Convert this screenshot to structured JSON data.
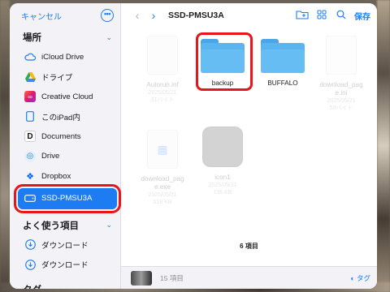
{
  "sidebar": {
    "cancel_label": "キャンセル",
    "more_glyph": "•••",
    "locations_title": "場所",
    "locations": [
      {
        "label": "iCloud Drive",
        "icon": "cloud-icon"
      },
      {
        "label": "ドライブ",
        "icon": "google-drive-icon"
      },
      {
        "label": "Creative Cloud",
        "icon": "creative-cloud-icon"
      },
      {
        "label": "このiPad内",
        "icon": "ipad-icon"
      },
      {
        "label": "Documents",
        "icon": "documents-icon"
      },
      {
        "label": "Drive",
        "icon": "drive-icon"
      },
      {
        "label": "Dropbox",
        "icon": "dropbox-icon"
      },
      {
        "label": "SSD-PMSU3A",
        "icon": "external-drive-icon",
        "selected": true
      }
    ],
    "favorites_title": "よく使う項目",
    "favorites": [
      {
        "label": "ダウンロード",
        "icon": "download-icon"
      },
      {
        "label": "ダウンロード",
        "icon": "download-icon"
      }
    ],
    "tags_title": "タグ"
  },
  "toolbar": {
    "title": "SSD-PMSU3A",
    "back_glyph": "‹",
    "forward_glyph": "›",
    "save_label": "保存"
  },
  "files": [
    {
      "name": "Autorun.inf",
      "meta": "2025/05/21\n31バイト",
      "kind": "doc",
      "dim": true
    },
    {
      "name": "backup",
      "meta": "",
      "kind": "folder",
      "highlighted": true
    },
    {
      "name": "BUFFALO",
      "meta": "",
      "kind": "folder"
    },
    {
      "name": "download_pag\ne.ini",
      "meta": "2025/05/21\n58バイト",
      "kind": "doc",
      "dim": true
    },
    {
      "name": "download_pag\ne.exe",
      "meta": "2025/05/21\n518 KB",
      "kind": "exe",
      "dim": true
    },
    {
      "name": "icon1",
      "meta": "2025/05/21\n136 KB",
      "kind": "drive-image",
      "dim": true
    }
  ],
  "footer": {
    "count": "6 項目",
    "items_text": "15 項目",
    "tag_label": "タグ"
  },
  "colors": {
    "accent": "#1e7cf2",
    "highlight": "#e8161c",
    "folder": "#5ab4f0"
  }
}
